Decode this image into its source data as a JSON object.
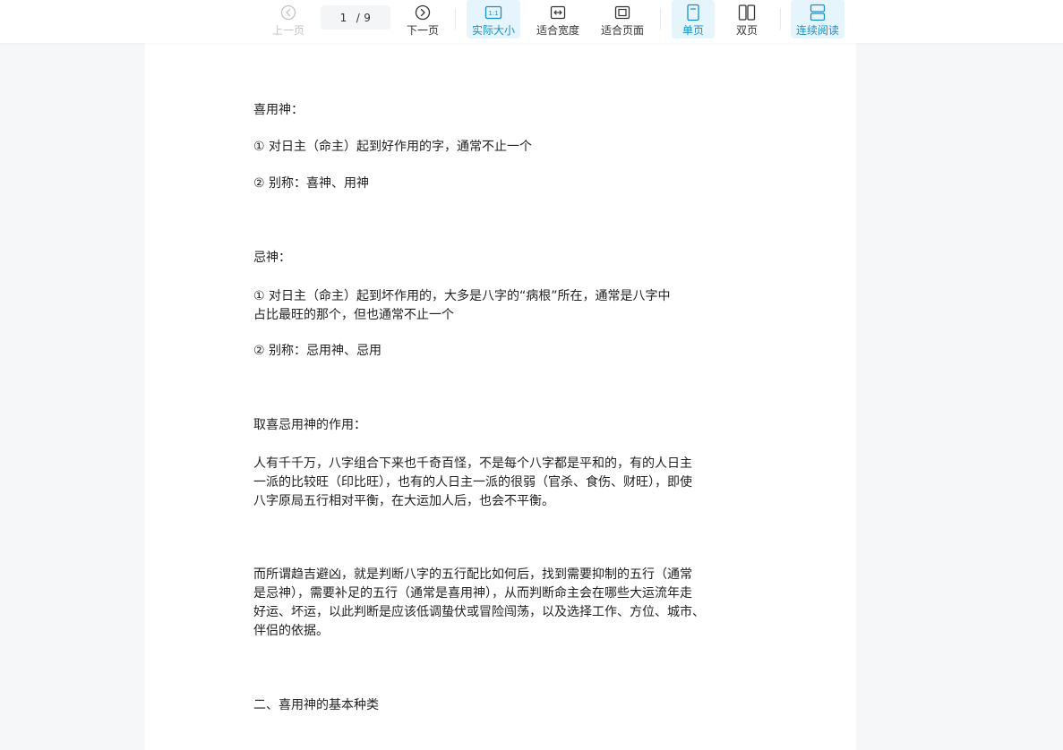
{
  "toolbar": {
    "prev_label": "上一页",
    "next_label": "下一页",
    "page_current": "1",
    "page_total": "9",
    "page_sep": "/",
    "actual_size_label": "实际大小",
    "fit_width_label": "适合宽度",
    "fit_page_label": "适合页面",
    "single_page_label": "单页",
    "double_page_label": "双页",
    "continuous_label": "连续阅读",
    "accent_color": "#1890c7"
  },
  "document": {
    "paragraphs": [
      "喜用神：",
      "① 对日主（命主）起到好作用的字，通常不止一个",
      "② 别称：喜神、用神",
      "忌神：",
      "① 对日主（命主）起到坏作用的，大多是八字的“病根”所在，通常是八字中",
      "占比最旺的那个，但也通常不止一个",
      "② 别称：忌用神、忌用",
      "取喜忌用神的作用：",
      "人有千千万，八字组合下来也千奇百怪，不是每个八字都是平和的，有的人日主",
      "一派的比较旺（印比旺），也有的人日主一派的很弱（官杀、食伤、财旺），即使",
      "八字原局五行相对平衡，在大运加人后，也会不平衡。",
      "而所谓趋吉避凶，就是判断八字的五行配比如何后，找到需要抑制的五行（通常",
      "是忌神），需要补足的五行（通常是喜用神），从而判断命主会在哪些大运流年走",
      "好运、坏运，以此判断是应该低调蛰伏或冒险闯荡，以及选择工作、方位、城市、",
      "伴侣的依据。",
      "二、喜用神的基本种类"
    ]
  }
}
